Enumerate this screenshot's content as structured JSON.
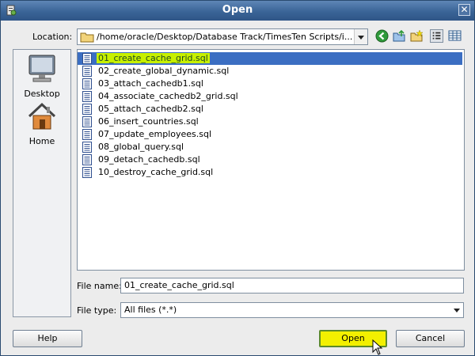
{
  "window": {
    "title": "Open"
  },
  "location": {
    "label": "Location:",
    "path": "/home/oracle/Desktop/Database Track/TimesTen Scripts/i..."
  },
  "places": [
    {
      "label": "Desktop"
    },
    {
      "label": "Home"
    }
  ],
  "files": [
    "01_create_cache_grid.sql",
    "02_create_global_dynamic.sql",
    "03_attach_cachedb1.sql",
    "04_associate_cachedb2_grid.sql",
    "05_attach_cachedb2.sql",
    "06_insert_countries.sql",
    "07_update_employees.sql",
    "08_global_query.sql",
    "09_detach_cachedb.sql",
    "10_destroy_cache_grid.sql"
  ],
  "selected_index": 0,
  "file_name": {
    "label": "File name:",
    "value": "01_create_cache_grid.sql"
  },
  "file_type": {
    "label": "File type:",
    "value": "All files (*.*)"
  },
  "buttons": {
    "help": "Help",
    "open": "Open",
    "cancel": "Cancel"
  },
  "colors": {
    "titlebar": "#3a6497",
    "selection": "#3b6ec2",
    "highlight": "#c7f000",
    "open_button": "#f3f000"
  }
}
